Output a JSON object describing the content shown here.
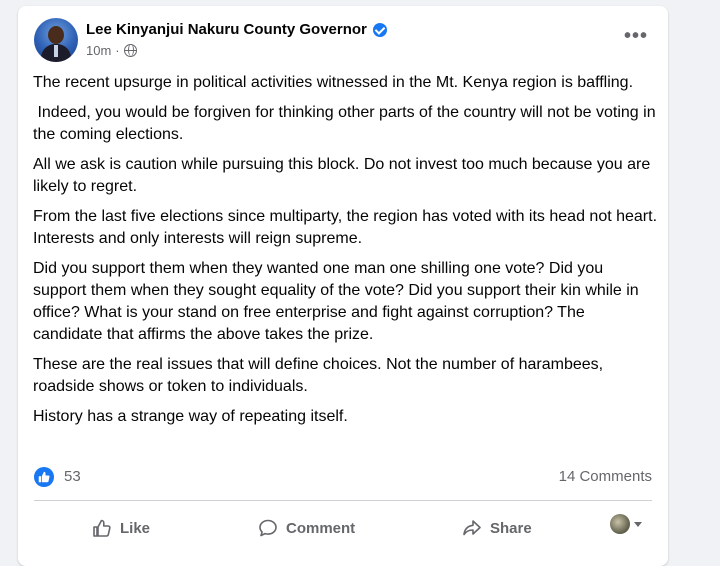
{
  "post": {
    "author": "Lee Kinyanjui Nakuru County Governor",
    "time": "10m",
    "dot": "·",
    "more_label": "•••",
    "paragraphs": [
      "The recent upsurge in political activities witnessed in the Mt. Kenya region is baffling.",
      " Indeed, you would be forgiven for thinking other parts of the country will not be voting in the coming elections.",
      "All we ask is caution while pursuing this block. Do not invest too much because you are likely to regret.",
      "From the last five elections since multiparty, the region has voted with its head not heart. Interests and only interests will reign supreme.",
      "Did you support them when they wanted one man one shilling one vote? Did you support them when they sought equality of the vote? Did you support their kin while in office? What is your stand on free enterprise and fight against corruption? The candidate that affirms the above takes the prize.",
      "These are the real issues that will define choices. Not the number of harambees, roadside shows or token to individuals.",
      "History has a strange way of repeating itself."
    ]
  },
  "stats": {
    "likes": "53",
    "comments": "14 Comments"
  },
  "actions": {
    "like": "Like",
    "comment": "Comment",
    "share": "Share"
  },
  "colors": {
    "accent": "#1877f2",
    "secondary_text": "#65676b",
    "background": "#f0f2f5"
  },
  "icons": [
    "verified-badge-icon",
    "globe-icon",
    "more-options-icon",
    "like-reaction-icon",
    "thumbs-up-icon",
    "comment-bubble-icon",
    "share-arrow-icon",
    "caret-down-icon"
  ]
}
